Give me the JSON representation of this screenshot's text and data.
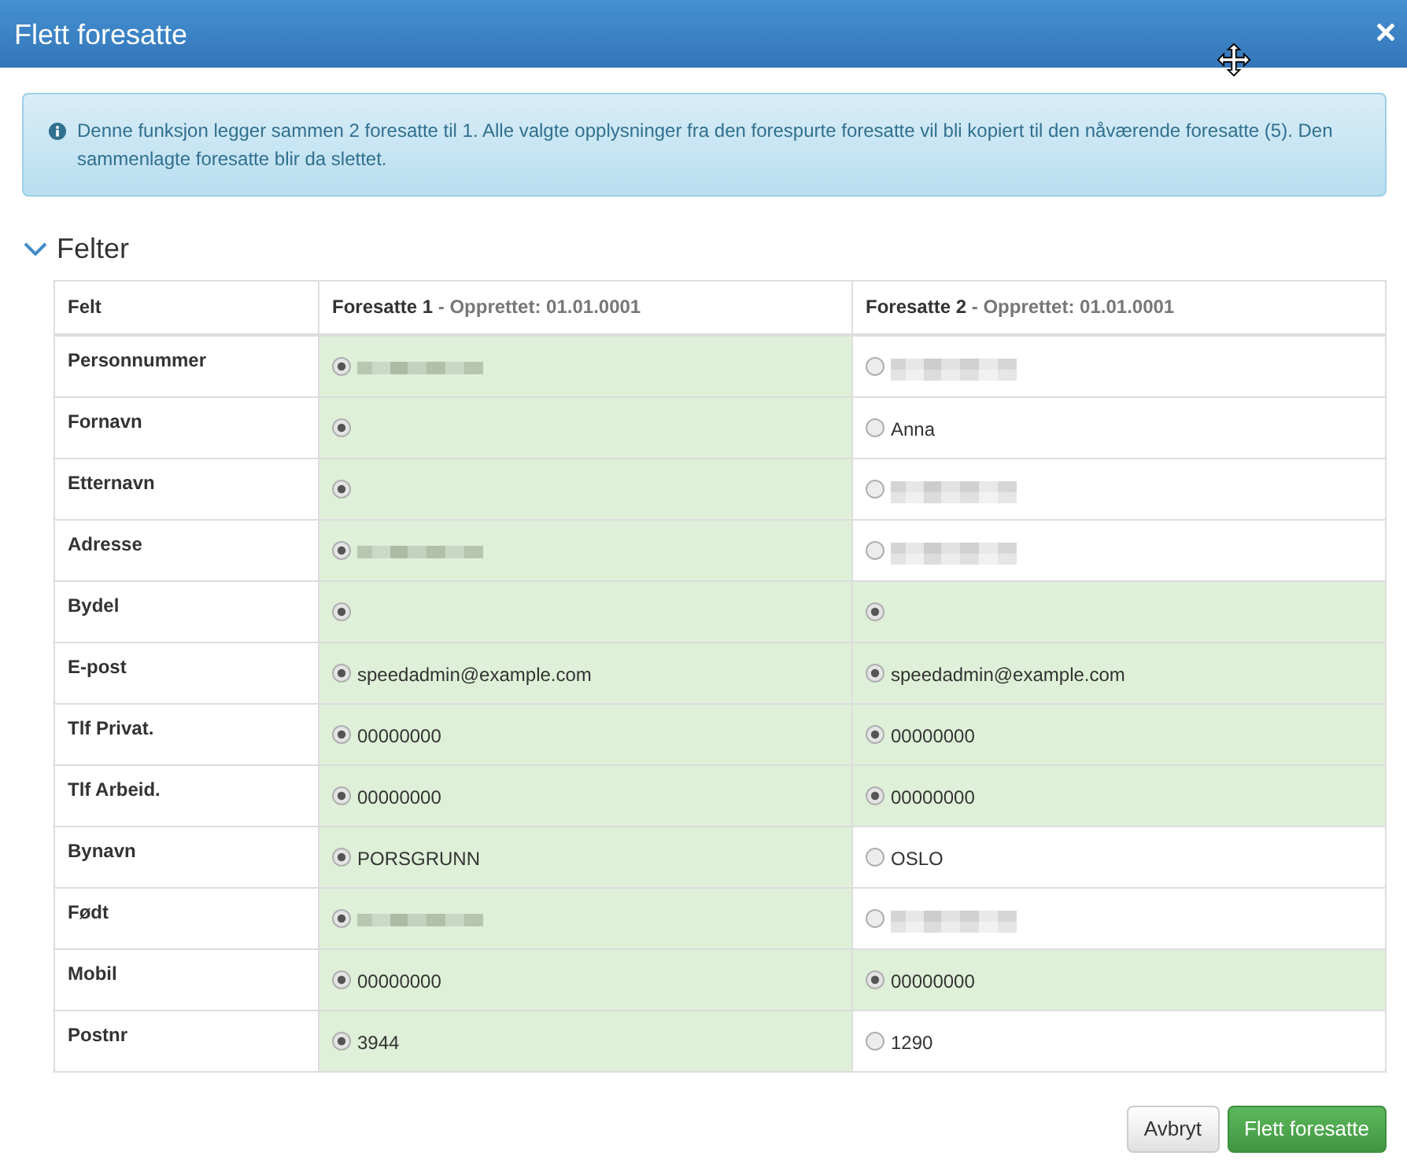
{
  "dialog": {
    "title": "Flett foresatte"
  },
  "alert": {
    "text": "Denne funksjon legger sammen 2 foresatte til 1. Alle valgte opplysninger fra den forespurte foresatte vil bli kopiert til den nåværende foresatte (5). Den sammenlagte foresatte blir da slettet."
  },
  "section": {
    "title": "Felter",
    "expanded": true
  },
  "table": {
    "label_heading": "Felt",
    "columns": [
      {
        "title": "Foresatte 1",
        "subtitle": "- Opprettet: 01.01.0001"
      },
      {
        "title": "Foresatte 2",
        "subtitle": "- Opprettet: 01.01.0001"
      }
    ],
    "rows": [
      {
        "label": "Personnummer",
        "cells": [
          {
            "selected": true,
            "redacted": true
          },
          {
            "selected": false,
            "redacted": true
          }
        ]
      },
      {
        "label": "Fornavn",
        "cells": [
          {
            "selected": true
          },
          {
            "selected": false,
            "value": "Anna"
          }
        ]
      },
      {
        "label": "Etternavn",
        "cells": [
          {
            "selected": true
          },
          {
            "selected": false,
            "redacted": true
          }
        ]
      },
      {
        "label": "Adresse",
        "cells": [
          {
            "selected": true,
            "redacted": true
          },
          {
            "selected": false,
            "redacted": true
          }
        ]
      },
      {
        "label": "Bydel",
        "cells": [
          {
            "selected": true
          },
          {
            "selected": true
          }
        ]
      },
      {
        "label": "E-post",
        "cells": [
          {
            "selected": true,
            "value": "speedadmin@example.com"
          },
          {
            "selected": true,
            "value": "speedadmin@example.com"
          }
        ]
      },
      {
        "label": "Tlf Privat.",
        "cells": [
          {
            "selected": true,
            "value": "00000000"
          },
          {
            "selected": true,
            "value": "00000000"
          }
        ]
      },
      {
        "label": "Tlf Arbeid.",
        "cells": [
          {
            "selected": true,
            "value": "00000000"
          },
          {
            "selected": true,
            "value": "00000000"
          }
        ]
      },
      {
        "label": "Bynavn",
        "cells": [
          {
            "selected": true,
            "value": "PORSGRUNN"
          },
          {
            "selected": false,
            "value": "OSLO"
          }
        ]
      },
      {
        "label": "Født",
        "cells": [
          {
            "selected": true,
            "redacted": true
          },
          {
            "selected": false,
            "redacted": true
          }
        ]
      },
      {
        "label": "Mobil",
        "cells": [
          {
            "selected": true,
            "value": "00000000"
          },
          {
            "selected": true,
            "value": "00000000"
          }
        ]
      },
      {
        "label": "Postnr",
        "cells": [
          {
            "selected": true,
            "value": "3944"
          },
          {
            "selected": false,
            "value": "1290"
          }
        ]
      }
    ]
  },
  "buttons": [
    {
      "label": "Avbryt",
      "kind": "default"
    },
    {
      "label": "Flett foresatte",
      "kind": "primary"
    }
  ]
}
